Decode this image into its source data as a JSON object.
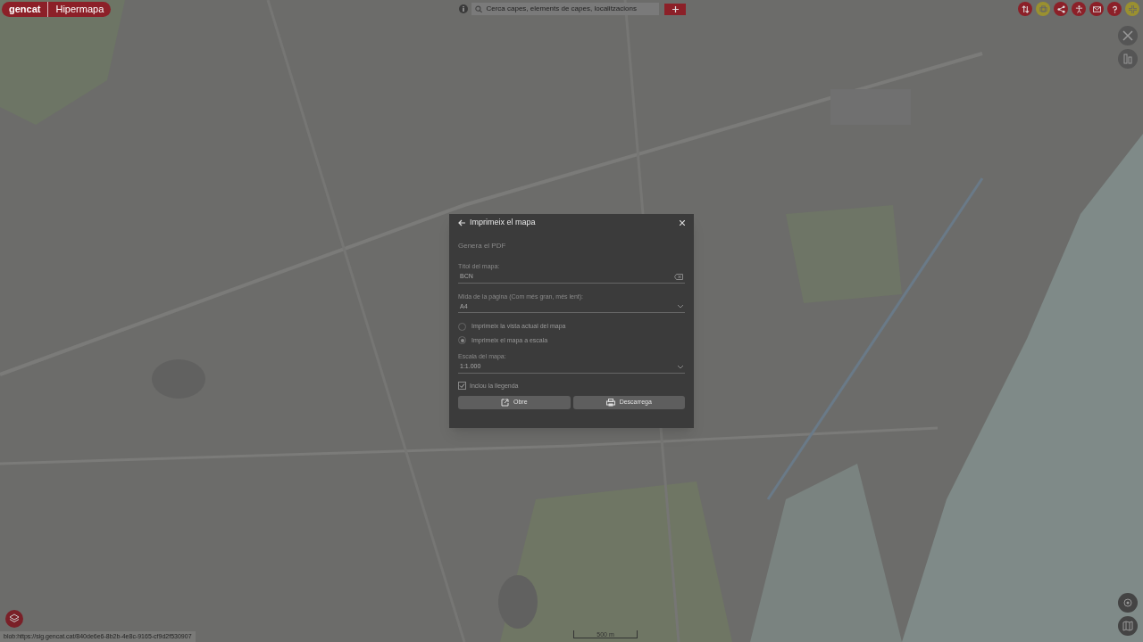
{
  "header": {
    "brand": "gencat",
    "app": "Hipermapa"
  },
  "search": {
    "placeholder": "Cerca capes, elements de capes, localitzacions"
  },
  "dialog": {
    "title": "Imprimeix el mapa",
    "subtitle": "Genera el PDF",
    "fields": [
      {
        "kind": "text",
        "label": "Títol del mapa:",
        "value": "BCN"
      },
      {
        "kind": "select",
        "label": "Mida de la pàgina (Com més gran, més lent):",
        "value": "A4"
      }
    ],
    "modes": [
      {
        "label": "Imprimeix la vista actual del mapa",
        "selected": false
      },
      {
        "label": "Imprimeix el mapa a escala",
        "selected": true
      }
    ],
    "scale": {
      "label": "Escala del mapa:",
      "value": "1:1.000"
    },
    "legend": {
      "label": "Inclou la llegenda",
      "checked": true
    },
    "buttons": [
      {
        "kind": "open",
        "label": "Obre"
      },
      {
        "kind": "download",
        "label": "Descarrega"
      }
    ]
  },
  "scale_bar": "500 m",
  "status_url": "blob:https://sig.gencat.cat/840de6e6-8b2b-4e8c-9165-cf9d2f530907"
}
